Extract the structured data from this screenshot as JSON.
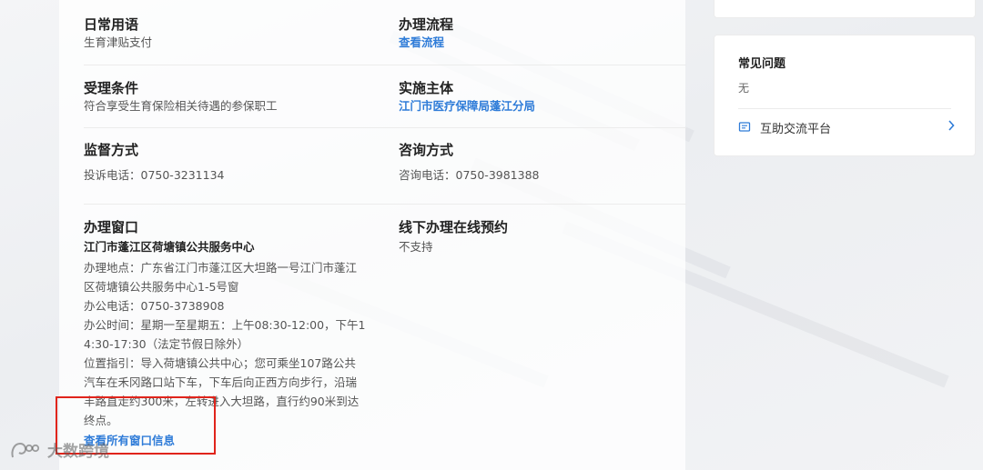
{
  "items": {
    "common_phrase": {
      "title": "日常用语",
      "value": "生育津贴支付"
    },
    "process": {
      "title": "办理流程",
      "link": "查看流程"
    },
    "conditions": {
      "title": "受理条件",
      "value": "符合享受生育保险相关待遇的参保职工"
    },
    "implementer": {
      "title": "实施主体",
      "link": "江门市医疗保障局蓬江分局"
    },
    "supervision": {
      "title": "监督方式",
      "value": "投诉电话：0750-3231134"
    },
    "consult": {
      "title": "咨询方式",
      "value": "咨询电话：0750-3981388"
    },
    "window": {
      "title": "办理窗口",
      "name": "江门市蓬江区荷塘镇公共服务中心",
      "address_1": "办理地点：广东省江门市蓬江区大坦路一号江门市蓬江",
      "address_2": "区荷塘镇公共服务中心1-5号窗",
      "phone": "办公电话：0750-3738908",
      "hours_1": "办公时间：星期一至星期五：上午08:30-12:00，下午1",
      "hours_2": "4:30-17:30（法定节假日除外）",
      "guide_1": "位置指引：导入荷塘镇公共中心；您可乘坐107路公共",
      "guide_2": "汽车在禾冈路口站下车，下车后向正西方向步行，沿瑞",
      "guide_3": "丰路直走约300米，左转进入大坦路，直行约90米到达",
      "guide_4": "终点。",
      "all_link": "查看所有窗口信息"
    },
    "offline": {
      "title": "线下办理在线预约",
      "value": "不支持"
    }
  },
  "sidebar": {
    "faq_title": "常见问题",
    "faq_value": "无",
    "platform_label": "互助交流平台",
    "icons": {
      "platform": "chat-icon",
      "chevron": "chevron-right-icon"
    }
  },
  "watermark": {
    "text": "大数跨境"
  },
  "colors": {
    "link": "#2f7cd8",
    "highlight": "#e0241b"
  }
}
